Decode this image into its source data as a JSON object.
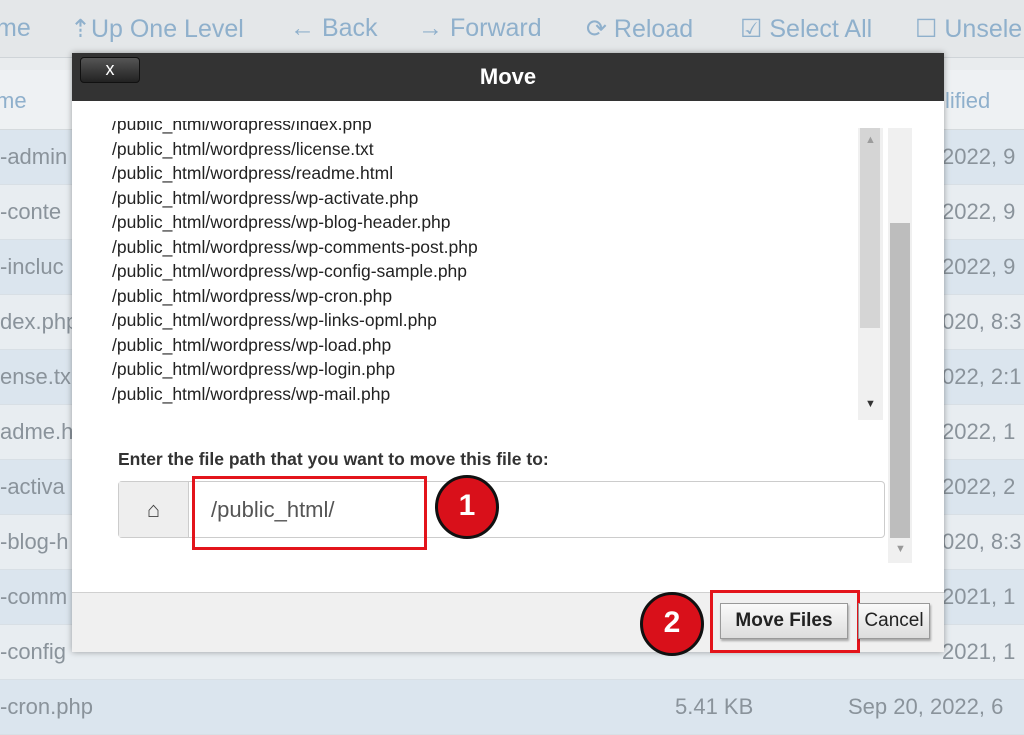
{
  "toolbar": {
    "items": [
      {
        "label": "me",
        "icon": ""
      },
      {
        "label": "Up One Level",
        "icon": "arrow-up-icon"
      },
      {
        "label": "Back",
        "icon": "arrow-left-icon"
      },
      {
        "label": "Forward",
        "icon": "arrow-right-icon"
      },
      {
        "label": "Reload",
        "icon": "reload-icon"
      },
      {
        "label": "Select All",
        "icon": "checkbox-checked-icon"
      },
      {
        "label": "Unsele",
        "icon": "checkbox-empty-icon"
      }
    ]
  },
  "table": {
    "header_name": "me",
    "header_modified": "lified",
    "rows": [
      {
        "name": "-admin",
        "modified": "2022, 9"
      },
      {
        "name": "-conte",
        "modified": "2022, 9"
      },
      {
        "name": "-incluc",
        "modified": "2022, 9"
      },
      {
        "name": "dex.php",
        "modified": "020, 8:3"
      },
      {
        "name": "ense.tx",
        "modified": "022, 2:1"
      },
      {
        "name": "adme.h",
        "modified": "2022, 1"
      },
      {
        "name": "-activa",
        "modified": "2022, 2"
      },
      {
        "name": "-blog-h",
        "modified": "020, 8:3"
      },
      {
        "name": "-comm",
        "modified": "2021, 1"
      },
      {
        "name": "-config",
        "modified": "2021, 1"
      },
      {
        "name": "-cron.php",
        "size": "5.41 KB",
        "modified": "Sep 20, 2022, 6"
      }
    ]
  },
  "dialog": {
    "title": "Move",
    "close_label": "x",
    "files": [
      "/public_html/wordpress/index.php",
      "/public_html/wordpress/license.txt",
      "/public_html/wordpress/readme.html",
      "/public_html/wordpress/wp-activate.php",
      "/public_html/wordpress/wp-blog-header.php",
      "/public_html/wordpress/wp-comments-post.php",
      "/public_html/wordpress/wp-config-sample.php",
      "/public_html/wordpress/wp-cron.php",
      "/public_html/wordpress/wp-links-opml.php",
      "/public_html/wordpress/wp-load.php",
      "/public_html/wordpress/wp-login.php",
      "/public_html/wordpress/wp-mail.php"
    ],
    "path_label": "Enter the file path that you want to move this file to:",
    "path_value": "/public_html/",
    "move_label": "Move Files",
    "cancel_label": "Cancel",
    "step1": "1",
    "step2": "2"
  },
  "colors": {
    "highlight": "#e3141b",
    "badge": "#d9101a",
    "header": "#333333"
  }
}
